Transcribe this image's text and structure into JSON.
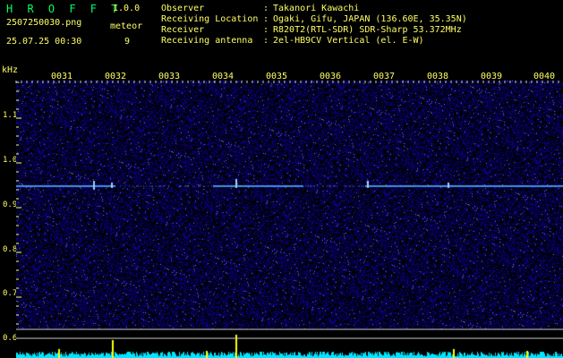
{
  "header": {
    "app_title": "H R O F F T",
    "app_version": "1.0.0",
    "filename": "2507250030.png",
    "timestamp": "25.07.25 00:30",
    "meteor_label": "meteor",
    "meteor_count": "9"
  },
  "info": [
    {
      "key": "Observer",
      "value": "Takanori Kawachi"
    },
    {
      "key": "Receiving Location",
      "value": "Ogaki, Gifu, JAPAN (136.60E, 35.35N)"
    },
    {
      "key": "Receiver",
      "value": "R820T2(RTL-SDR) SDR-Sharp 53.372MHz"
    },
    {
      "key": "Receiving antenna",
      "value": "2el-HB9CV Vertical (el. E-W)"
    }
  ],
  "separator": ":",
  "axis": {
    "y_unit": "kHz",
    "y_ticks": [
      "1.1",
      "1.0",
      "0.9",
      "0.8",
      "0.7",
      "0.6"
    ],
    "x_ticks": [
      "0031",
      "0032",
      "0033",
      "0034",
      "0035",
      "0036",
      "0037",
      "0038",
      "0039",
      "0040"
    ]
  },
  "colors": {
    "background": "#000000",
    "text": "#ffff66",
    "title": "#00ff66",
    "noise": "#1a1aff",
    "beacon": "#4fa8ff",
    "meteor": "#ffff00",
    "power_trace": "#00e6ff",
    "divider": "#c8c8c8"
  }
}
